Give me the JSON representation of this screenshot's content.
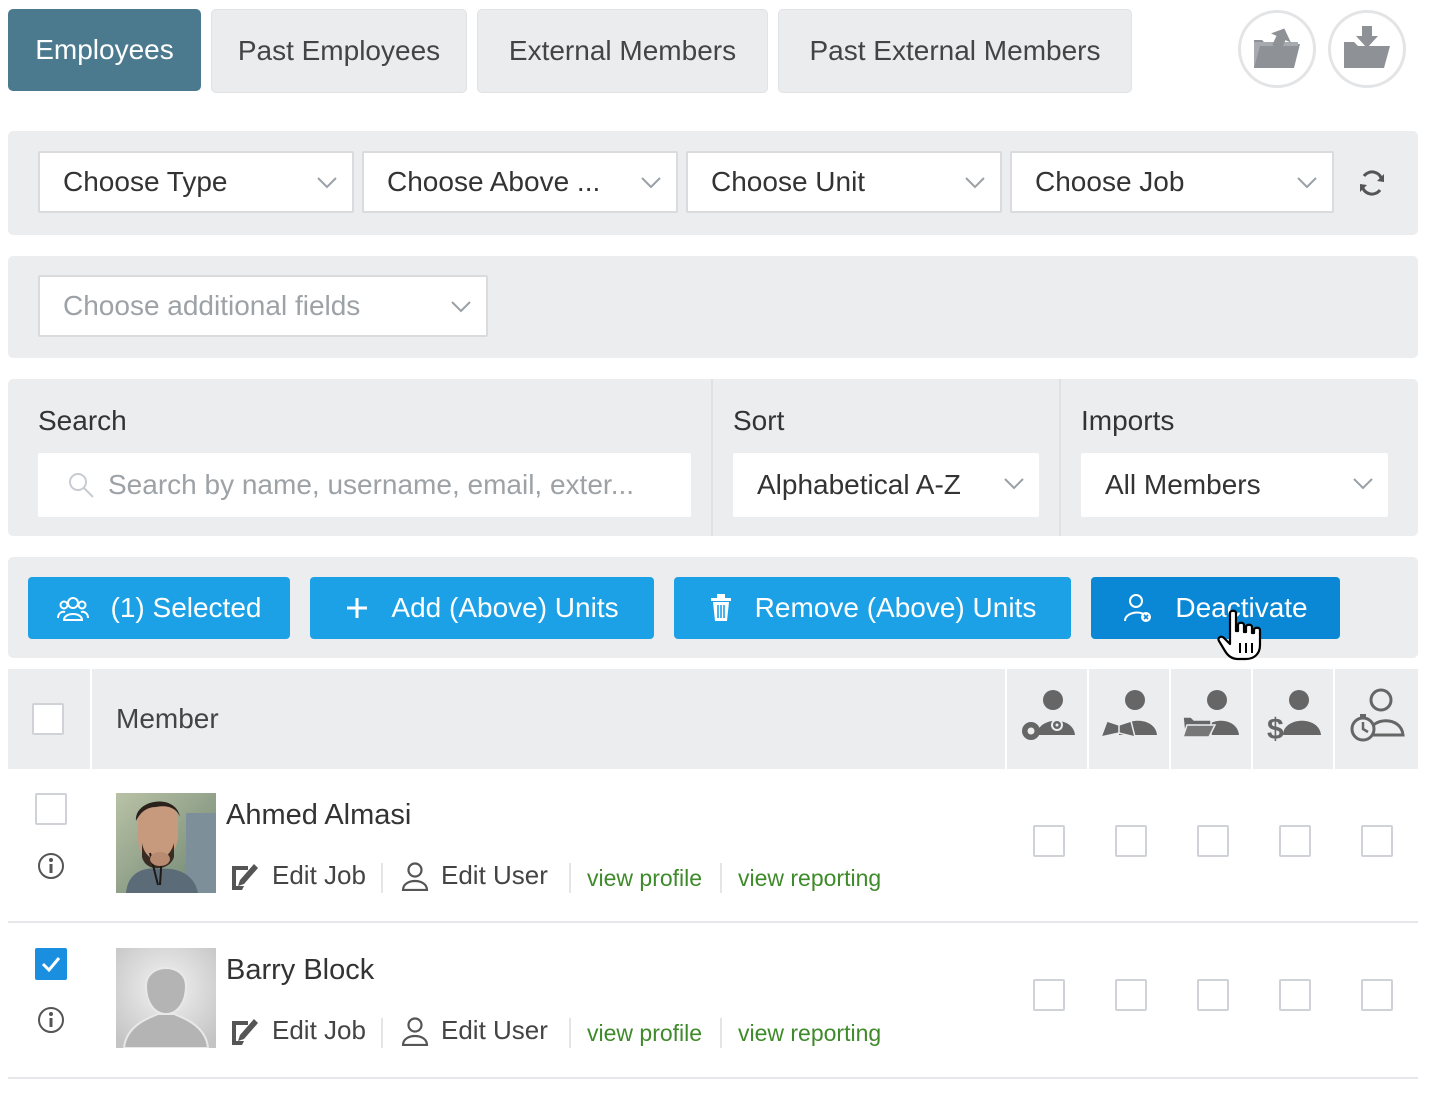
{
  "tabs": [
    {
      "label": "Employees",
      "active": true
    },
    {
      "label": "Past Employees",
      "active": false
    },
    {
      "label": "External Members",
      "active": false
    },
    {
      "label": "Past External Members",
      "active": false
    }
  ],
  "header_icons": [
    "folder-export-icon",
    "folder-import-icon"
  ],
  "filters": {
    "type": "Choose Type",
    "above": "Choose Above ...",
    "unit": "Choose Unit",
    "job": "Choose Job",
    "refresh_icon": "refresh-icon",
    "additional_fields_placeholder": "Choose additional fields"
  },
  "search": {
    "label": "Search",
    "placeholder": "Search by name, username, email, exter..."
  },
  "sort": {
    "label": "Sort",
    "value": "Alphabetical A-Z"
  },
  "imports": {
    "label": "Imports",
    "value": "All Members"
  },
  "actions": {
    "selected": "(1) Selected",
    "add_units": "Add (Above) Units",
    "remove_units": "Remove (Above) Units",
    "deactivate": "Deactivate"
  },
  "table": {
    "member_header": "Member",
    "permission_icons": [
      "user-settings-icon",
      "user-learning-icon",
      "user-documents-icon",
      "user-salary-icon",
      "user-time-icon"
    ],
    "rows": [
      {
        "name": "Ahmed Almasi",
        "checked": false,
        "edit_job": "Edit Job",
        "edit_user": "Edit User",
        "view_profile": "view profile",
        "view_reporting": "view reporting"
      },
      {
        "name": "Barry Block",
        "checked": true,
        "edit_job": "Edit Job",
        "edit_user": "Edit User",
        "view_profile": "view profile",
        "view_reporting": "view reporting"
      }
    ]
  },
  "colors": {
    "active_tab": "#4b7a8f",
    "action_button": "#1da1e6",
    "action_button_hover": "#0a88d6",
    "link_green": "#3f8a2a",
    "panel_bg": "#ecedef"
  }
}
